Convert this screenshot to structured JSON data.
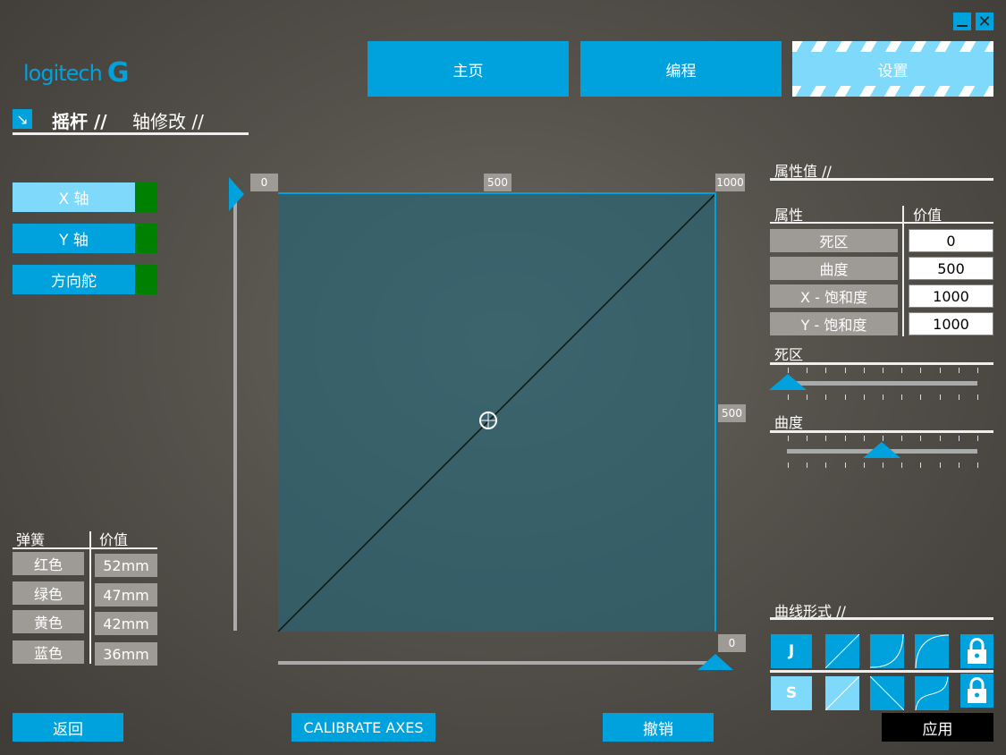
{
  "window": {
    "minimize_icon": "minimize-icon",
    "close_icon": "close-icon"
  },
  "logo": {
    "text": "logitech"
  },
  "nav": {
    "home": "主页",
    "programming": "编程",
    "settings": "设置"
  },
  "breadcrumb": {
    "part1": "摇杆 //",
    "part2": "轴修改 //"
  },
  "axes": [
    {
      "label": "X 轴",
      "selected": true
    },
    {
      "label": "Y 轴"
    },
    {
      "label": "方向舵"
    }
  ],
  "springs": {
    "header_name": "弹簧",
    "header_value": "价值",
    "rows": [
      {
        "name": "红色",
        "value": "52mm"
      },
      {
        "name": "绿色",
        "value": "47mm"
      },
      {
        "name": "黄色",
        "value": "42mm"
      },
      {
        "name": "蓝色",
        "value": "36mm"
      }
    ]
  },
  "graph": {
    "top_labels": [
      "0",
      "500",
      "1000"
    ],
    "right_labels": [
      "500",
      "0"
    ],
    "background": "#3f6872"
  },
  "properties": {
    "title": "属性值 //",
    "header_name": "属性",
    "header_value": "价值",
    "rows": [
      {
        "name": "死区",
        "value": "0"
      },
      {
        "name": "曲度",
        "value": "500"
      },
      {
        "name": "X - 饱和度",
        "value": "1000"
      },
      {
        "name": "Y - 饱和度",
        "value": "1000"
      }
    ]
  },
  "sliders": {
    "deadzone_label": "死区",
    "deadzone_value": 0,
    "curve_label": "曲度",
    "curve_value": 500
  },
  "curve_forms": {
    "title": "曲线形式 //",
    "j": "J",
    "s": "S"
  },
  "footer": {
    "back": "返回",
    "calibrate": "CALIBRATE AXES",
    "undo": "撤销",
    "apply": "应用"
  },
  "colors": {
    "accent": "#00a2dd",
    "selected": "#7fd9fb",
    "indicator": "#008000"
  }
}
